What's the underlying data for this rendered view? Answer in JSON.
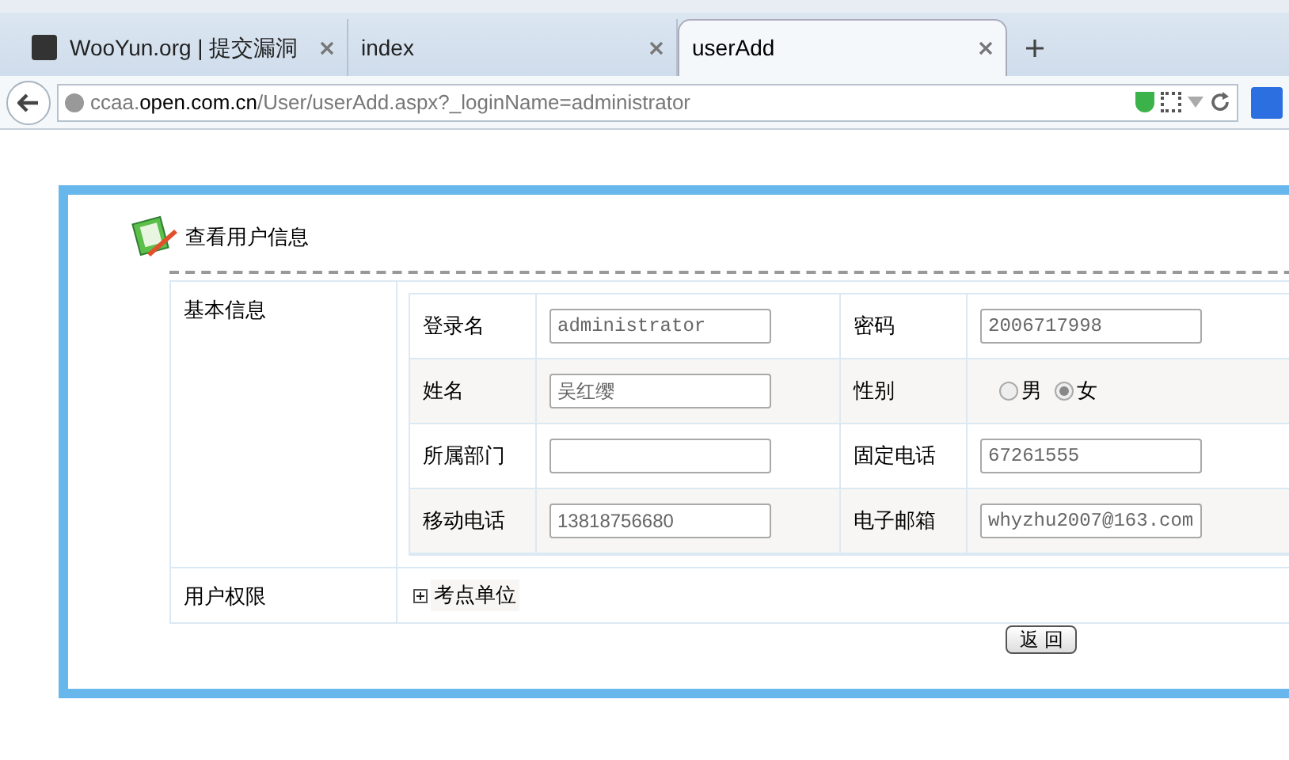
{
  "tabs": [
    {
      "label": "WooYun.org | 提交漏洞",
      "selected": false
    },
    {
      "label": "index",
      "selected": false
    },
    {
      "label": "userAdd",
      "selected": true
    }
  ],
  "address_bar": {
    "host_prefix": "ccaa.",
    "host": "open.com.cn",
    "path": "/User/userAdd.aspx?_loginName=administrator"
  },
  "panel": {
    "title": "查看用户信息",
    "basic_info": {
      "label": "基本信息",
      "rows": [
        {
          "fields": [
            {
              "label": "登录名",
              "kind": "mono",
              "value": "administrator"
            },
            {
              "label": "密码",
              "kind": "mono",
              "value": "2006717998"
            }
          ]
        },
        {
          "fields": [
            {
              "label": "姓名",
              "kind": "text",
              "value": "吴红缨"
            },
            {
              "label": "性别",
              "kind": "radio",
              "options": [
                {
                  "label": "男",
                  "selected": false
                },
                {
                  "label": "女",
                  "selected": true
                }
              ]
            }
          ]
        },
        {
          "fields": [
            {
              "label": "所属部门",
              "kind": "text"
            },
            {
              "label": "固定电话",
              "kind": "mono",
              "value": "67261555"
            }
          ]
        },
        {
          "fields": [
            {
              "label": "移动电话",
              "kind": "text",
              "value": "13818756680"
            },
            {
              "label": "电子邮箱",
              "kind": "mono",
              "value": "whyzhu2007@163.com"
            }
          ]
        }
      ]
    },
    "permissions": {
      "label": "用户权限",
      "tree": [
        {
          "label": "考点单位",
          "expanded": false
        }
      ]
    },
    "back_button": "返 回"
  }
}
